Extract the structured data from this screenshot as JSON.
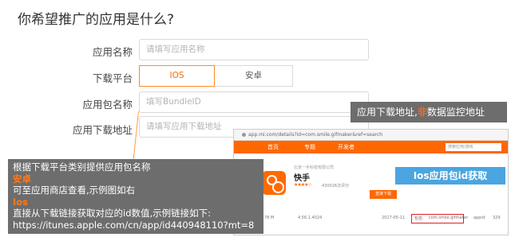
{
  "page_title": "你希望推广的应用是什么?",
  "form": {
    "app_name_label": "应用名称",
    "app_name_placeholder": "请填写应用名称",
    "platform_label": "下载平台",
    "platform_ios": "IOS",
    "platform_android": "安卓",
    "selected_platform": "IOS",
    "package_label": "应用包名称",
    "package_placeholder": "填写BundleID",
    "download_url_label": "应用下载地址",
    "download_url_placeholder": "请填写应用下载地址"
  },
  "callout_top": {
    "text_before": "应用下载地址,",
    "highlight": "非",
    "text_after": "数据监控地址"
  },
  "callout_bottom": {
    "line1": "根据下载平台类别提供应用包名称",
    "android_title": "安卓",
    "line2": "可至应用商店查看,示例图如右",
    "ios_title": "Ios",
    "line3": "直接从下载链接获取对应的id数值,示例链接如下:",
    "line4": "https://itunes.apple.com/cn/app/id440948110?mt=8"
  },
  "example_shot": {
    "url": "app.mi.com/details?id=com.smile.gifmaker&ref=search",
    "nav_items": [
      "首页",
      "专题",
      "开发者"
    ],
    "search_placeholder": "搜索应用/游戏",
    "developer": "北京一手科技有限公司",
    "app_name": "快手",
    "rating_stars": "★★★★☆",
    "rating_count": "430026次评分",
    "download_button": "直接下载",
    "meta_size": "29.78 M",
    "meta_version": "4.56.1.4024",
    "meta_date": "2017-05-11",
    "package_key": "包名:",
    "package_value": "com.smile.gifmaker",
    "appid_key": "appid:",
    "appid_value": "329",
    "badge": "Ios应用包id获取",
    "colors": {
      "accent": "#ff6700",
      "badge": "#4aa5e0"
    }
  },
  "colors": {
    "highlight": "#ff6a1a",
    "callout_bg": "#6d6d6d"
  }
}
